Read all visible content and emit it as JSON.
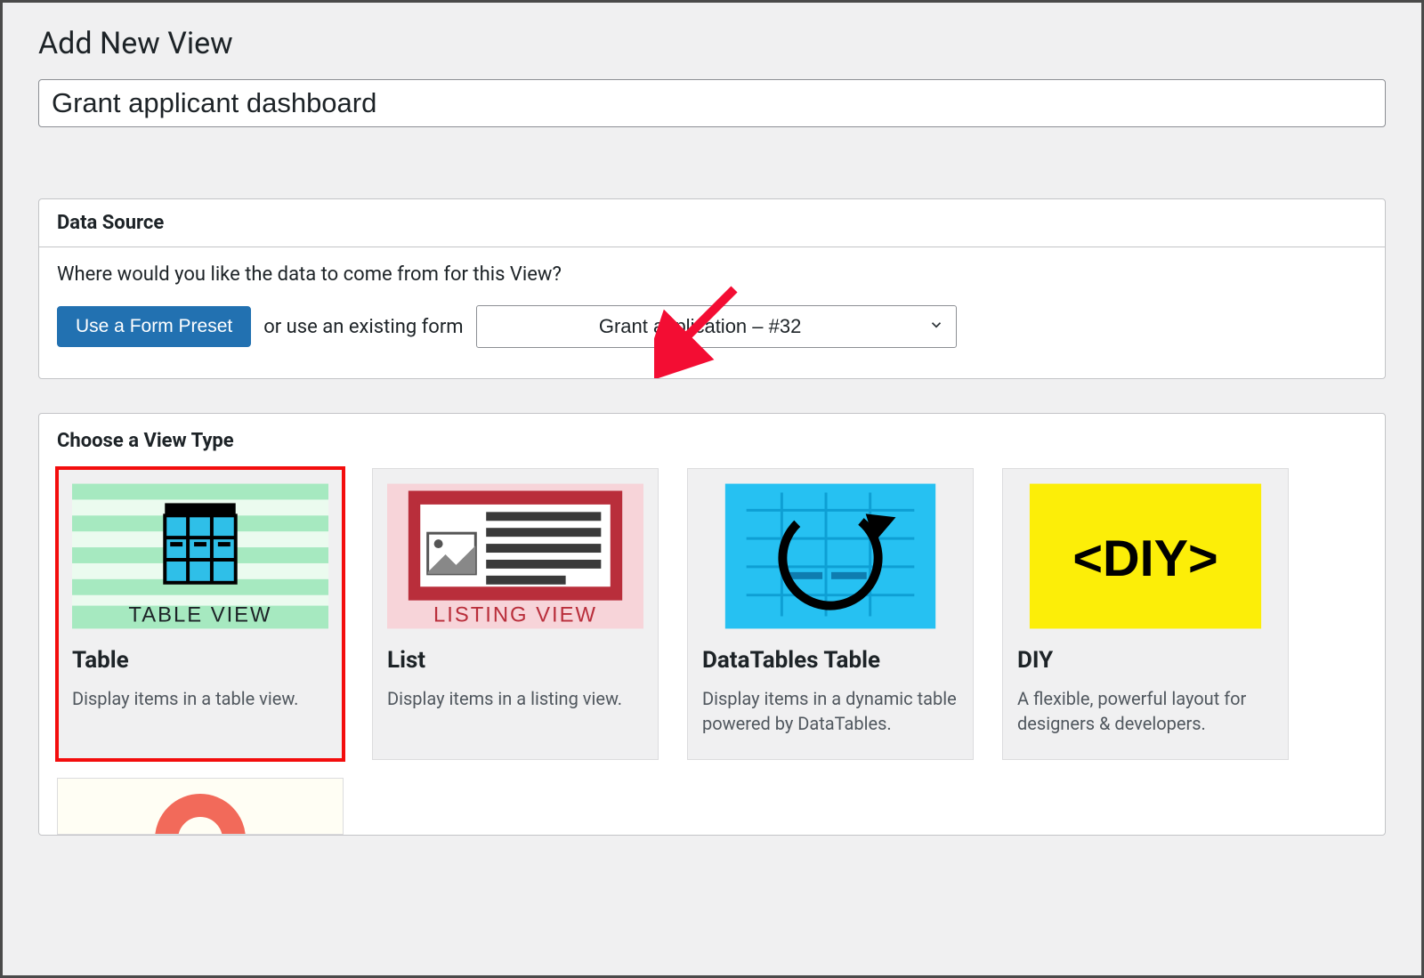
{
  "page": {
    "title": "Add New View",
    "view_name_value": "Grant applicant dashboard"
  },
  "data_source": {
    "header": "Data Source",
    "prompt": "Where would you like the data to come from for this View?",
    "preset_button": "Use a Form Preset",
    "or_text": "or use an existing form",
    "selected_form": "Grant application – #32"
  },
  "view_type": {
    "header": "Choose a View Type",
    "cards": [
      {
        "title": "Table",
        "desc": "Display items in a table view.",
        "thumb_label": "TABLE VIEW",
        "selected": true
      },
      {
        "title": "List",
        "desc": "Display items in a listing view.",
        "thumb_label": "LISTING VIEW",
        "selected": false
      },
      {
        "title": "DataTables Table",
        "desc": "Display items in a dynamic table powered by DataTables.",
        "thumb_label": "",
        "selected": false
      },
      {
        "title": "DIY",
        "desc": "A flexible, powerful layout for designers & developers.",
        "thumb_label": "<DIY>",
        "selected": false
      }
    ]
  },
  "annotation": {
    "arrow_color": "#f30d33"
  }
}
